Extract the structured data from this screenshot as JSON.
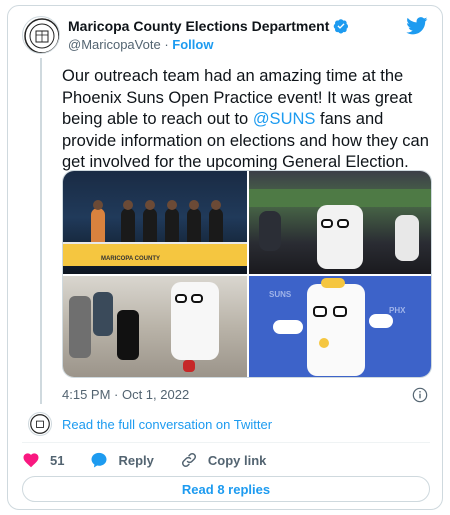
{
  "author": {
    "name": "Maricopa County Elections Department",
    "handle": "@MaricopaVote",
    "separator": "·",
    "follow_label": "Follow",
    "seal_text": "MARICOPA COUNTY"
  },
  "tweet": {
    "text_before": "Our outreach team had an amazing time at the Phoenix Suns Open Practice event! It was great being able to reach out to ",
    "mention": "@SUNS",
    "text_after": " fans and provide information on elections and how they can get involved for the upcoming General Election.",
    "timestamp": "4:15 PM · Oct 1, 2022"
  },
  "media": {
    "photo1_banner": "MARICOPA COUNTY",
    "photo4_brand": "SUNS",
    "photo4_brand2": "PHX"
  },
  "footer": {
    "conversation_link": "Read the full conversation on Twitter",
    "like_count": "51",
    "reply_label": "Reply",
    "copy_link_label": "Copy link",
    "read_replies_label": "Read 8 replies"
  },
  "icons": {
    "verified": "verified-badge-icon",
    "twitter": "twitter-bird-icon",
    "info": "info-icon",
    "like": "heart-icon",
    "reply": "speech-bubble-icon",
    "copy_link": "link-icon"
  },
  "colors": {
    "accent": "#1d9bf0",
    "like": "#f91880",
    "text": "#0f1419",
    "muted": "#536471"
  }
}
